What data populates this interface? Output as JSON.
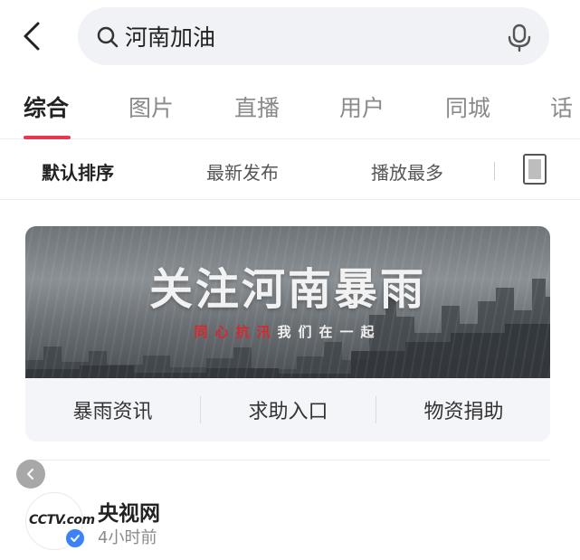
{
  "search": {
    "value": "河南加油",
    "back_icon": "chevron-left-icon",
    "search_icon": "search-icon",
    "mic_icon": "microphone-icon"
  },
  "tabs": [
    {
      "label": "综合",
      "active": true
    },
    {
      "label": "图片",
      "active": false
    },
    {
      "label": "直播",
      "active": false
    },
    {
      "label": "用户",
      "active": false
    },
    {
      "label": "同城",
      "active": false
    },
    {
      "label": "话",
      "active": false
    }
  ],
  "sort": {
    "options": [
      {
        "label": "默认排序",
        "active": true
      },
      {
        "label": "最新发布",
        "active": false
      },
      {
        "label": "播放最多",
        "active": false
      }
    ],
    "layout_icon": "layout-toggle-icon"
  },
  "banner": {
    "title": "关注河南暴雨",
    "subtitle_red": "同心抗汛",
    "subtitle_white": "我们在一起",
    "actions": [
      "暴雨资讯",
      "求助入口",
      "物资捐助"
    ]
  },
  "account": {
    "name": "央视网",
    "time": "4小时前",
    "logo_text": "CCTV.com",
    "verified_icon": "verified-check-icon"
  },
  "colors": {
    "accent": "#e8384f",
    "verified": "#3b82f6",
    "search_bg": "#f1f2f5",
    "card_bg": "#f4f5f8"
  }
}
